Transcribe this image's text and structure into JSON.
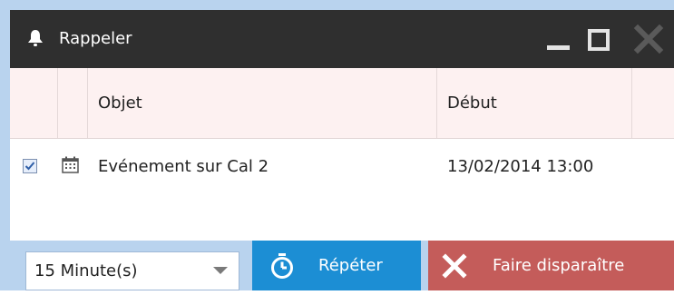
{
  "window": {
    "title": "Rappeler",
    "icon": "bell-icon",
    "controls": [
      "minimize-icon",
      "maximize-icon",
      "close-icon"
    ]
  },
  "table": {
    "columns": [
      "",
      "",
      "Objet",
      "Début"
    ],
    "rows": [
      {
        "checked": true,
        "icon": "calendar-icon",
        "subject": "Evénement sur Cal 2",
        "start": "13/02/2014 13:00"
      }
    ]
  },
  "footer": {
    "snooze_select_value": "15 Minute(s)",
    "repeat_label": "Répéter",
    "repeat_icon": "stopwatch-icon",
    "dismiss_label": "Faire disparaître",
    "dismiss_icon": "x-icon"
  },
  "colors": {
    "title_bar": "#2f2f2f",
    "header_bg": "#fdf1f1",
    "footer_bg": "#b9d3ee",
    "repeat_button": "#1c8ed4",
    "dismiss_button": "#c45c5a"
  }
}
